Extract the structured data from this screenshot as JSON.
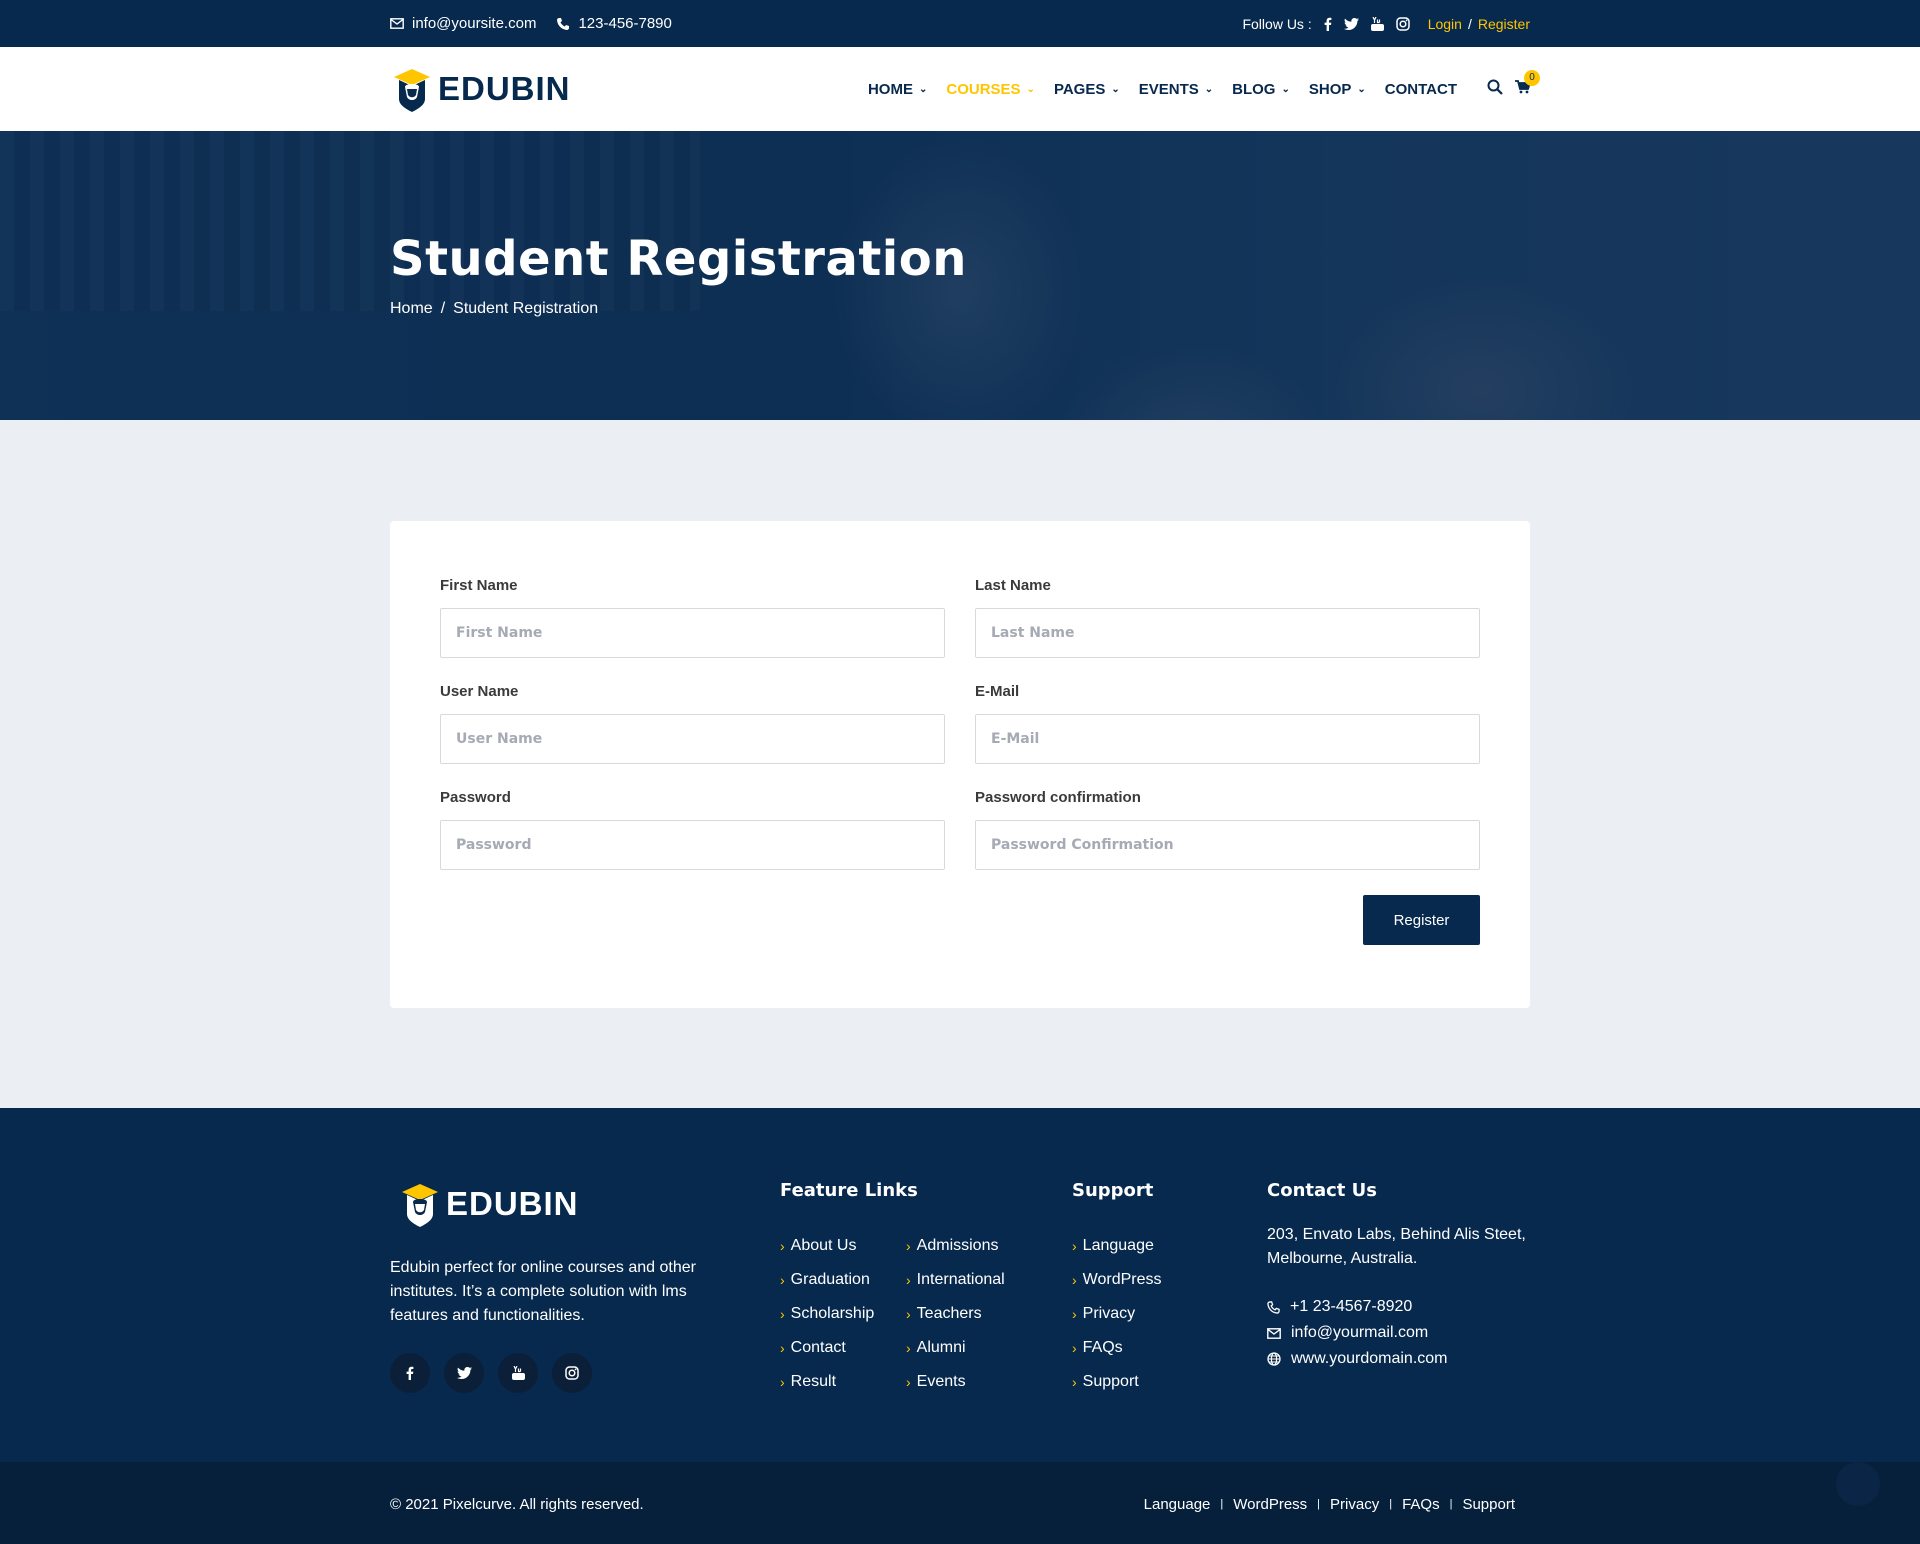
{
  "topbar": {
    "email": "info@yoursite.com",
    "phone": "123-456-7890",
    "follow_label": "Follow Us :",
    "login": "Login",
    "separator": "/",
    "register": "Register"
  },
  "brand": {
    "name": "EDUBIN",
    "accent": "#ffc600",
    "primary": "#07294d"
  },
  "nav": {
    "items": [
      {
        "label": "HOME",
        "has_dropdown": true
      },
      {
        "label": "COURSES",
        "has_dropdown": true,
        "active": true
      },
      {
        "label": "PAGES",
        "has_dropdown": true
      },
      {
        "label": "EVENTS",
        "has_dropdown": true
      },
      {
        "label": "BLOG",
        "has_dropdown": true
      },
      {
        "label": "SHOP",
        "has_dropdown": true
      },
      {
        "label": "CONTACT",
        "has_dropdown": false
      }
    ],
    "cart_count": "0"
  },
  "hero": {
    "title": "Student Registration",
    "breadcrumb": {
      "home": "Home",
      "sep": "/",
      "current": "Student Registration"
    }
  },
  "form": {
    "first_name": {
      "label": "First Name",
      "placeholder": "First Name"
    },
    "last_name": {
      "label": "Last Name",
      "placeholder": "Last Name"
    },
    "user_name": {
      "label": "User Name",
      "placeholder": "User Name"
    },
    "email": {
      "label": "E-Mail",
      "placeholder": "E-Mail"
    },
    "password": {
      "label": "Password",
      "placeholder": "Password"
    },
    "password_confirmation": {
      "label": "Password confirmation",
      "placeholder": "Password Confirmation"
    },
    "submit": "Register"
  },
  "footer": {
    "about": "Edubin perfect for online courses and other institutes. It’s a complete solution with lms features and functionalities.",
    "feature_links": {
      "title": "Feature Links",
      "col1": [
        "About Us",
        "Graduation",
        "Scholarship",
        "Contact",
        "Result"
      ],
      "col2": [
        "Admissions",
        "International",
        "Teachers",
        "Alumni",
        "Events"
      ]
    },
    "support": {
      "title": "Support",
      "links": [
        "Language",
        "WordPress",
        "Privacy",
        "FAQs",
        "Support"
      ]
    },
    "contact": {
      "title": "Contact Us",
      "address": "203, Envato Labs, Behind Alis Steet, Melbourne, Australia.",
      "phone": "+1 23-4567-8920",
      "email": "info@yourmail.com",
      "website": "www.yourdomain.com"
    }
  },
  "bottom": {
    "copyright": "© 2021 Pixelcurve. All rights reserved.",
    "links": [
      "Language",
      "WordPress",
      "Privacy",
      "FAQs",
      "Support"
    ]
  }
}
